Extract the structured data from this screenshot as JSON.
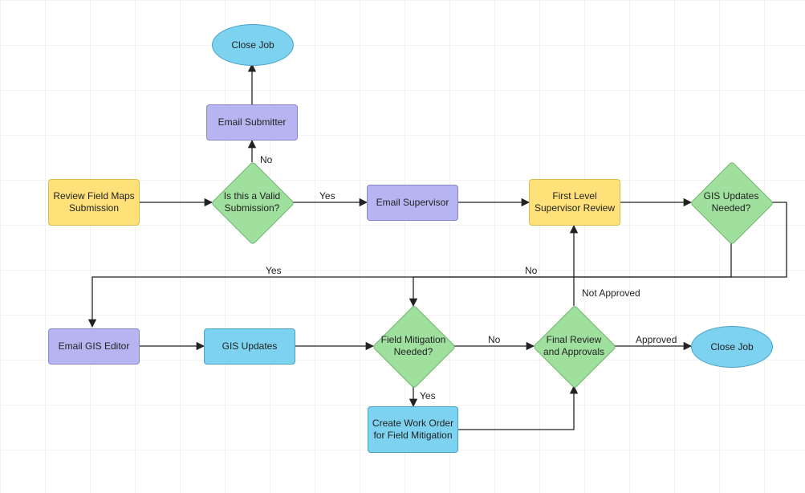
{
  "nodes": {
    "review": "Review Field Maps Submission",
    "valid": "Is this a Valid Submission?",
    "email_submitter": "Email Submitter",
    "close_top": "Close Job",
    "email_supervisor": "Email Supervisor",
    "first_level": "First Level Supervisor Review",
    "gis_needed": "GIS Updates Needed?",
    "email_gis": "Email GIS Editor",
    "gis_updates": "GIS Updates",
    "field_mit": "Field Mitigation Needed?",
    "create_wo": "Create Work Order for Field Mitigation",
    "final": "Final Review and Approvals",
    "close_right": "Close Job"
  },
  "edge_labels": {
    "valid_no": "No",
    "valid_yes": "Yes",
    "gis_yes": "Yes",
    "gis_no": "No",
    "mit_yes": "Yes",
    "mit_no": "No",
    "final_approved": "Approved",
    "final_not": "Not Approved"
  }
}
